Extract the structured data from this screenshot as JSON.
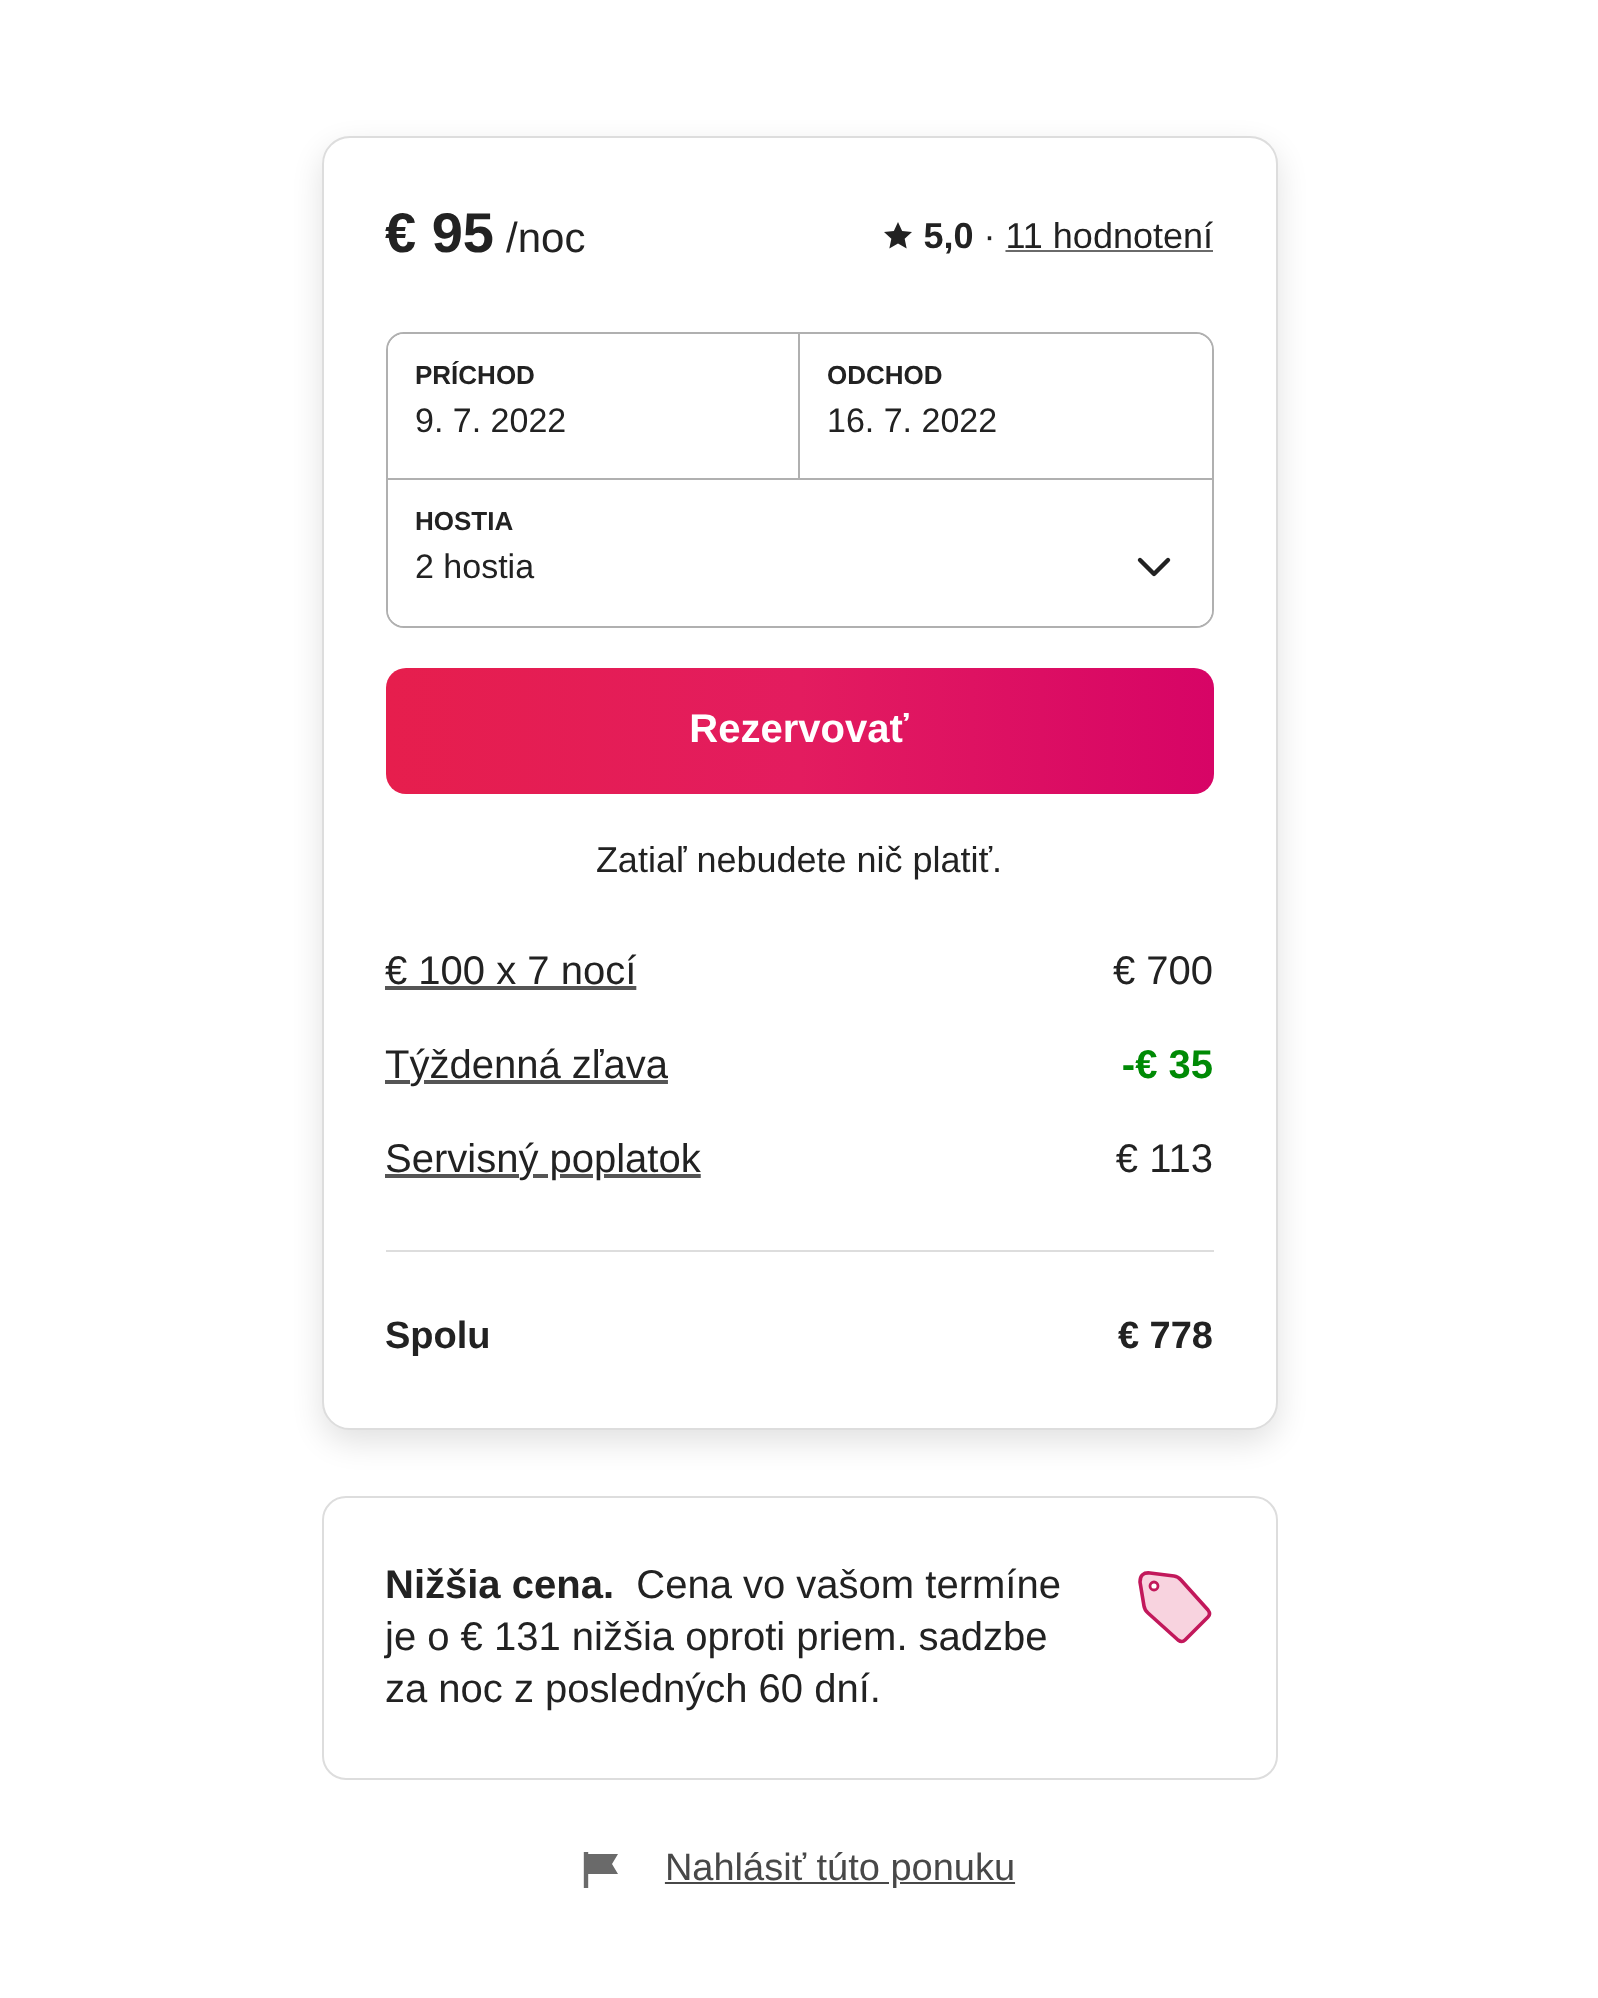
{
  "listing": {
    "price": "€ 95",
    "unit": "/noc",
    "rating": "5,0",
    "separator": "·",
    "reviews": "11 hodnotení"
  },
  "booking": {
    "fields": [
      {
        "kind": "date",
        "label": "PRÍCHOD",
        "value": "9. 7. 2022"
      },
      {
        "kind": "date",
        "label": "ODCHOD",
        "value": "16. 7. 2022"
      },
      {
        "kind": "select",
        "label": "HOSTIA",
        "value": "2 hostia"
      }
    ]
  },
  "reserve_button": "Rezervovať",
  "note": "Zatiaľ nebudete nič platiť.",
  "charges": [
    {
      "kind": "fee",
      "label": "€ 100 x 7 nocí",
      "amount": "€ 700"
    },
    {
      "kind": "discount",
      "label": "Týždenná zľava",
      "amount": "-€ 35"
    },
    {
      "kind": "fee",
      "label": "Servisný poplatok",
      "amount": "€ 113"
    }
  ],
  "total": {
    "label": "Spolu",
    "amount": "€ 778"
  },
  "notice": {
    "text": "**Nižšia cena.**  Cena vo vašom termíne je o € 131 nižšia oproti priem. sadzbe za noc z posledných 60 dní."
  },
  "report_link": "Nahlásiť túto ponuku"
}
